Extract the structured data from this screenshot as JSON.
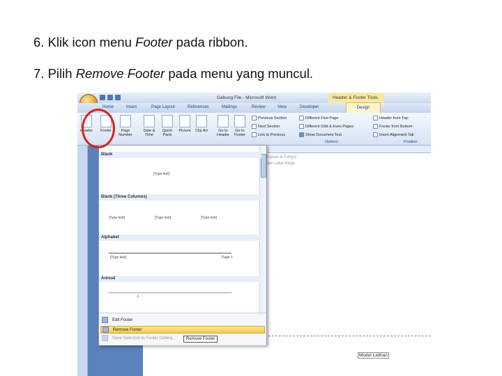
{
  "instructions": {
    "step6": {
      "num": "6.",
      "pre": "Klik icon menu",
      "em": "Footer",
      "post": "pada ribbon."
    },
    "step7": {
      "num": "7.",
      "pre": "Pilih",
      "em": "Remove Footer",
      "post": "pada menu yang muncul."
    }
  },
  "window": {
    "title": "Gabung File - Microsoft Word",
    "context_tab": "Header & Footer Tools"
  },
  "tabs": [
    "Home",
    "Insert",
    "Page Layout",
    "References",
    "Mailings",
    "Review",
    "View",
    "Developer",
    "Design"
  ],
  "ribbon": {
    "buttons": [
      "Header",
      "Footer",
      "Page Number",
      "Date & Time",
      "Quick Parts",
      "Picture",
      "Clip Art",
      "Go to Header",
      "Go to Footer"
    ],
    "navigation": [
      "Previous Section",
      "Next Section",
      "Link to Previous"
    ],
    "options": [
      "Different First Page",
      "Different Odd & Even Pages",
      "Show Document Text"
    ],
    "options_group": "Options",
    "position": [
      "Header from Top:",
      "Footer from Bottom:",
      "Insert Alignment Tab"
    ],
    "position_group": "Position"
  },
  "gallery": {
    "sections": [
      "Blank",
      "Blank (Three Columns)",
      "Alphabet",
      "Annual"
    ],
    "placeholder": "[Type text]",
    "alphabet_left": "[Type text]",
    "alphabet_right": "Page 1",
    "annual_page": "1",
    "menu": {
      "edit": "Edit Footer",
      "remove": "Remove Footer",
      "save": "Save Selection to Footer Gallery..."
    }
  },
  "tooltip": "Remove Footer",
  "document": {
    "line1": "... Tujuan & Fungsi",
    "line2": "... dan Laba Kerja",
    "modul": "Modul Latihan"
  },
  "colors": {
    "highlight": "#d8231e",
    "selected_item": "#f7c84f"
  }
}
